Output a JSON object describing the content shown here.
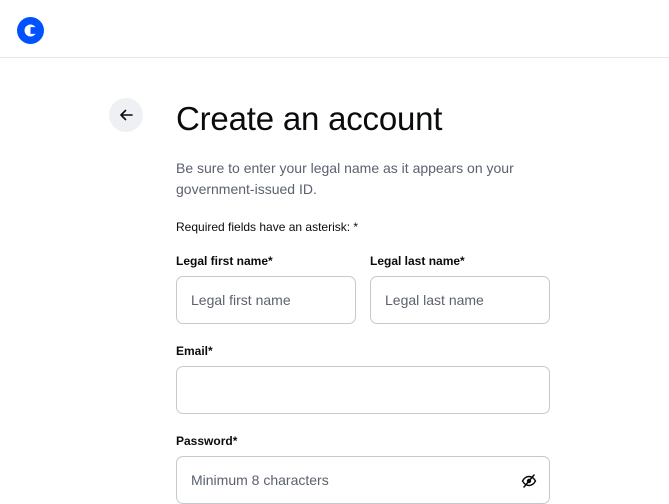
{
  "header": {
    "logo_name": "coinbase-logo",
    "brand_color": "#0052ff"
  },
  "form": {
    "title": "Create an account",
    "subtitle": "Be sure to enter your legal name as it appears on your government-issued ID.",
    "required_note": "Required fields have an asterisk: *",
    "first_name": {
      "label": "Legal first name*",
      "placeholder": "Legal first name",
      "value": ""
    },
    "last_name": {
      "label": "Legal last name*",
      "placeholder": "Legal last name",
      "value": ""
    },
    "email": {
      "label": "Email*",
      "placeholder": "",
      "value": ""
    },
    "password": {
      "label": "Password*",
      "placeholder": "Minimum 8 characters",
      "value": "",
      "toggle_icon": "eye-off-icon"
    }
  },
  "nav": {
    "back_icon": "arrow-left-icon"
  }
}
